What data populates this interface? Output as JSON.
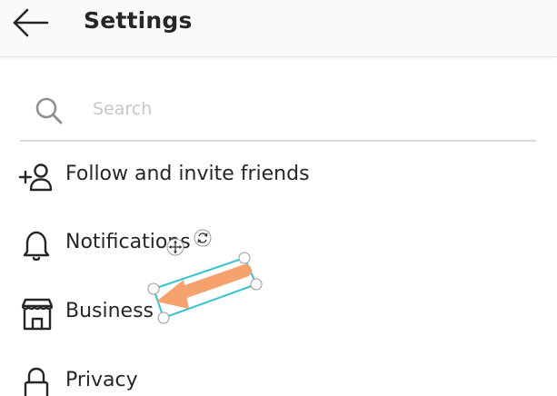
{
  "header": {
    "title": "Settings",
    "back_icon": "arrow-left-icon"
  },
  "search": {
    "placeholder": "Search",
    "value": "",
    "icon": "search-icon"
  },
  "menu": {
    "items": [
      {
        "label": "Follow and invite friends",
        "icon": "add-person-icon"
      },
      {
        "label": "Notifications",
        "icon": "bell-icon"
      },
      {
        "label": "Business",
        "icon": "storefront-icon"
      },
      {
        "label": "Privacy",
        "icon": "lock-icon"
      }
    ]
  },
  "annotation": {
    "icon": "arrow-annotation",
    "fill_color": "#f5a26e",
    "frame_color": "#35c4cf"
  }
}
